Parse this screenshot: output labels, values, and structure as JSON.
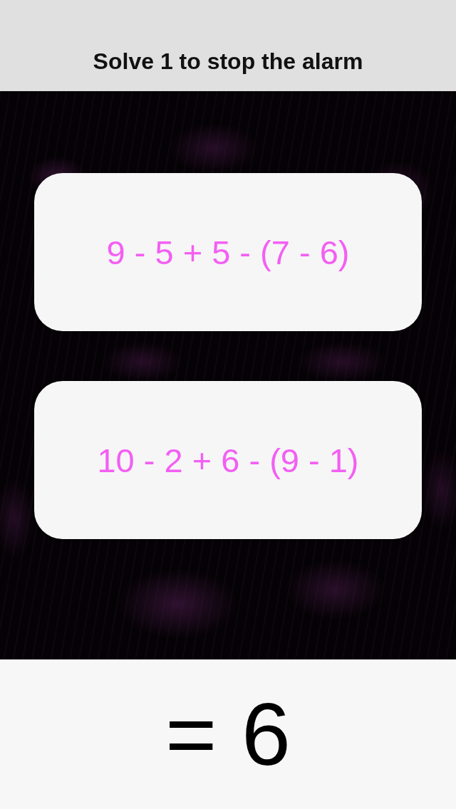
{
  "header": {
    "title": "Solve 1 to stop the alarm"
  },
  "choices": [
    {
      "expression": "9 - 5 + 5 - (7 - 6)"
    },
    {
      "expression": "10 - 2 + 6 - (9 - 1)"
    }
  ],
  "target": {
    "text": "= 6"
  }
}
